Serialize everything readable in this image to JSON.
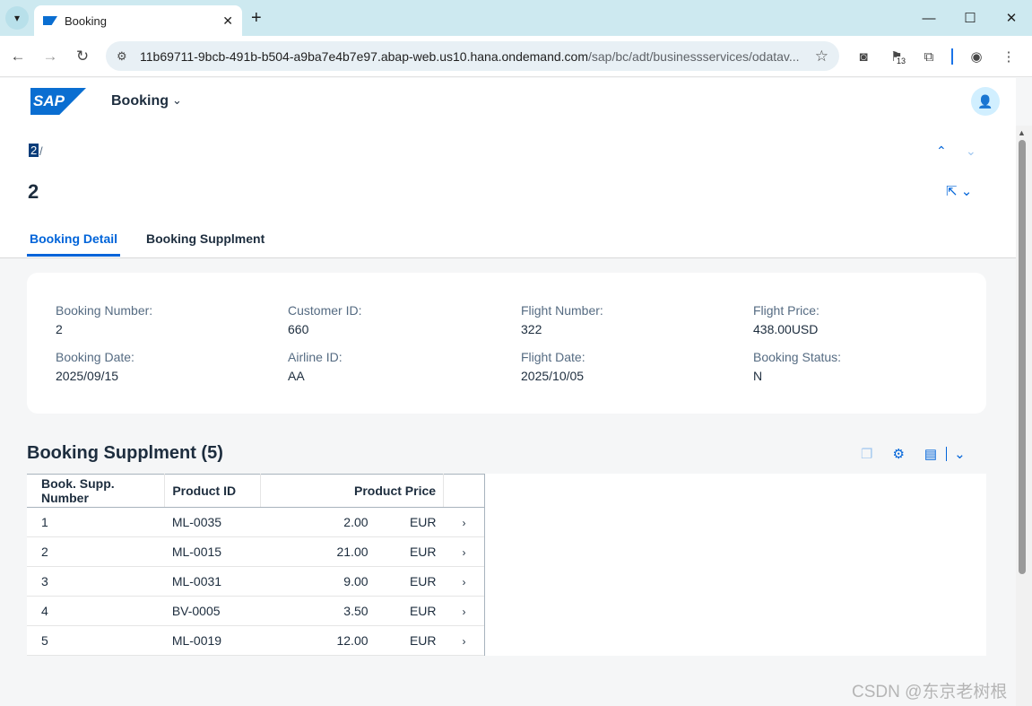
{
  "browser": {
    "tab_title": "Booking",
    "url_host": "11b69711-9bcb-491b-b504-a9ba7e4b7e97.abap-web.us10.hana.ondemand.com",
    "url_path": "/sap/bc/adt/businessservices/odatav...",
    "badge_count": "13"
  },
  "shell": {
    "logo_text": "SAP",
    "app_title": "Booking"
  },
  "header": {
    "breadcrumb_current": "2",
    "breadcrumb_sep": "/",
    "title": "2",
    "tabs": [
      {
        "label": "Booking Detail",
        "active": true
      },
      {
        "label": "Booking Supplment",
        "active": false
      }
    ]
  },
  "details": {
    "booking_number": {
      "label": "Booking Number:",
      "value": "2"
    },
    "customer_id": {
      "label": "Customer ID:",
      "value": "660"
    },
    "flight_number": {
      "label": "Flight Number:",
      "value": "322"
    },
    "flight_price": {
      "label": "Flight Price:",
      "value": "438.00USD"
    },
    "booking_date": {
      "label": "Booking Date:",
      "value": "2025/09/15"
    },
    "airline_id": {
      "label": "Airline ID:",
      "value": "AA"
    },
    "flight_date": {
      "label": "Flight Date:",
      "value": "2025/10/05"
    },
    "booking_status": {
      "label": "Booking Status:",
      "value": "N"
    }
  },
  "supplements": {
    "title": "Booking Supplment (5)",
    "columns": [
      "Book. Supp. Number",
      "Product ID",
      "Product Price"
    ],
    "rows": [
      {
        "num": "1",
        "product": "ML-0035",
        "price": "2.00",
        "currency": "EUR"
      },
      {
        "num": "2",
        "product": "ML-0015",
        "price": "21.00",
        "currency": "EUR"
      },
      {
        "num": "3",
        "product": "ML-0031",
        "price": "9.00",
        "currency": "EUR"
      },
      {
        "num": "4",
        "product": "BV-0005",
        "price": "3.50",
        "currency": "EUR"
      },
      {
        "num": "5",
        "product": "ML-0019",
        "price": "12.00",
        "currency": "EUR"
      }
    ]
  },
  "watermark": "CSDN @东京老树根"
}
